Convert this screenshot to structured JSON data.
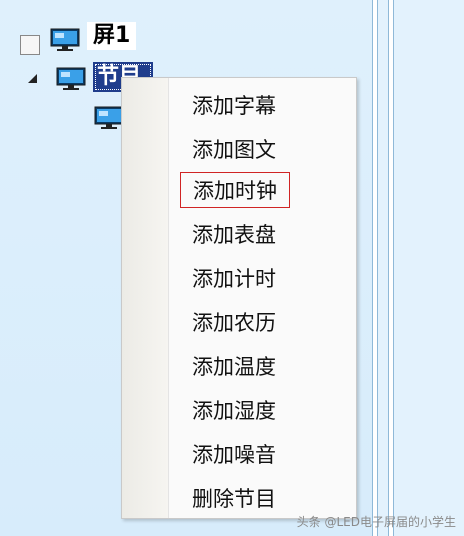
{
  "tree": {
    "screen_label": "屏1",
    "program_label": "节目"
  },
  "context_menu": {
    "items": [
      {
        "label": "添加字幕"
      },
      {
        "label": "添加图文"
      },
      {
        "label": "添加时钟",
        "highlighted": true
      },
      {
        "label": "添加表盘"
      },
      {
        "label": "添加计时"
      },
      {
        "label": "添加农历"
      },
      {
        "label": "添加温度"
      },
      {
        "label": "添加湿度"
      },
      {
        "label": "添加噪音"
      },
      {
        "label": "删除节目"
      }
    ]
  },
  "watermark": "头条 @LED电子屏届的小学生",
  "colors": {
    "selection": "#1f3d8c",
    "highlight_border": "#d02424",
    "panel_bg": "#dff0fc"
  }
}
